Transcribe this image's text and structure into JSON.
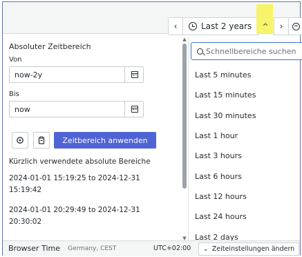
{
  "toolbar": {
    "prev_icon": "chevron-left",
    "range_icon": "clock-icon",
    "range_label": "Last 2 years",
    "expand_icon": "chevron-up",
    "next_icon": "chevron-right",
    "zoom_icon": "zoom-out-icon",
    "prev_glyph": "‹",
    "next_glyph": "›",
    "caret_glyph": "^"
  },
  "absolute": {
    "title": "Absoluter Zeitbereich",
    "from_label": "Von",
    "from_value": "now-2y",
    "to_label": "Bis",
    "to_value": "now",
    "apply_label": "Zeitbereich anwenden"
  },
  "recent": {
    "title": "Kürzlich verwendete absolute Bereiche",
    "items": [
      {
        "line1": "2024-01-01 15:19:25 to 2024-12-31",
        "line2": "15:19:42"
      },
      {
        "line1": "2024-01-01 20:29:49 to 2024-12-31",
        "line2": "20:30:02"
      }
    ]
  },
  "quick": {
    "placeholder": "Schnellbereiche suchen",
    "options": [
      "Last 5 minutes",
      "Last 15 minutes",
      "Last 30 minutes",
      "Last 1 hour",
      "Last 3 hours",
      "Last 6 hours",
      "Last 12 hours",
      "Last 24 hours",
      "Last 2 days"
    ]
  },
  "footer": {
    "label": "Browser Time",
    "sub": "Germany, CEST",
    "utc": "UTC+02:00",
    "settings_label": "Zeiteinstellungen ändern",
    "settings_glyph": "⌄"
  },
  "colors": {
    "accent": "#4f63d6",
    "highlight": "#f7f46a",
    "focus_border": "#3d71d9"
  }
}
